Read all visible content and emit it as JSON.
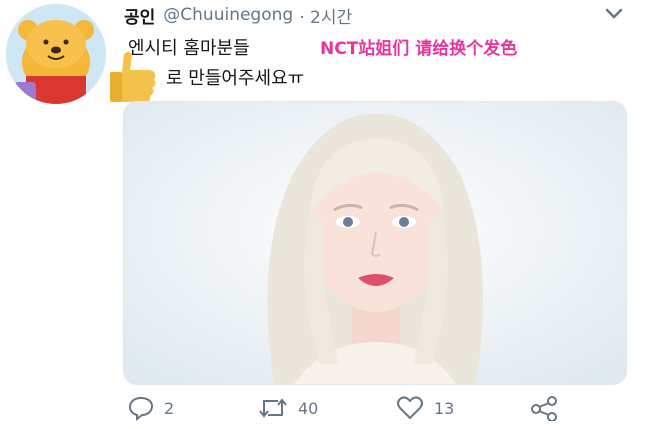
{
  "tweet": {
    "display_name": "공인",
    "handle": "@Chuuinegong",
    "time": "· 2시간",
    "text_line1": "엔시티 홈마분들",
    "text_line2": "로 만들어주세요ㅠ",
    "caption_cn": "NCT站姐们 请给换个发色"
  },
  "actions": {
    "reply": {
      "icon": "reply-icon",
      "count": "2"
    },
    "retweet": {
      "icon": "retweet-icon",
      "count": "40"
    },
    "like": {
      "icon": "heart-icon",
      "count": "13"
    },
    "share": {
      "icon": "share-icon"
    }
  },
  "colors": {
    "text": "#14171a",
    "secondary": "#657786",
    "caption": "#e8359d",
    "border": "#e1e8ed"
  }
}
